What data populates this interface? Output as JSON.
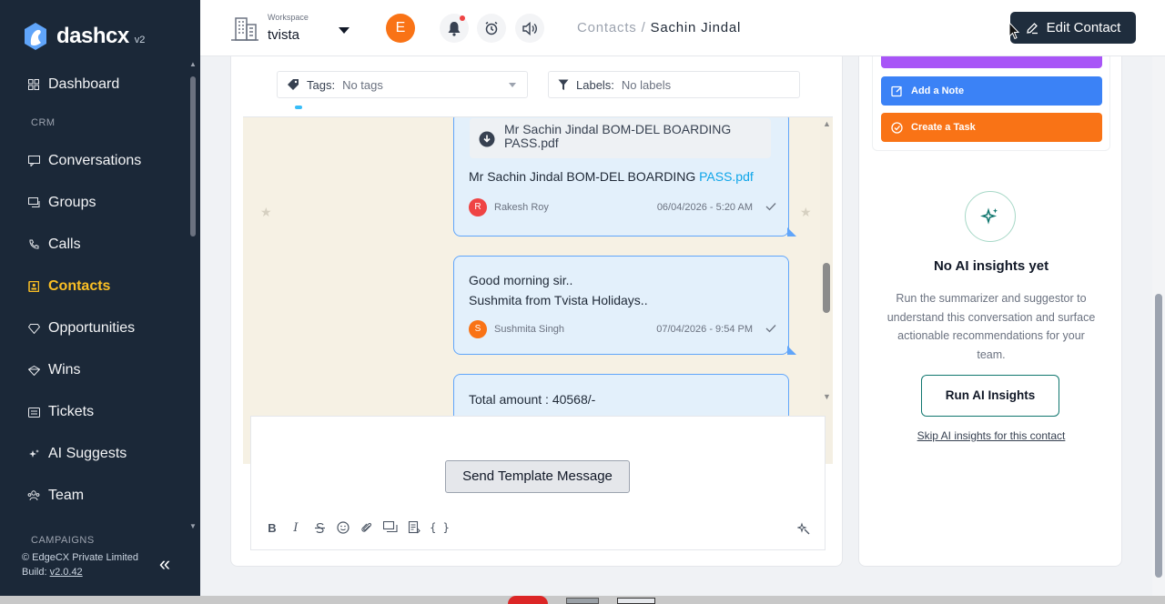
{
  "app": {
    "name": "dashcx",
    "version": "v2"
  },
  "sidebar": {
    "items": [
      {
        "label": "Dashboard",
        "icon": "dashboard-icon"
      },
      {
        "section": "CRM"
      },
      {
        "label": "Conversations",
        "icon": "chat-icon"
      },
      {
        "label": "Groups",
        "icon": "group-chat-icon"
      },
      {
        "label": "Calls",
        "icon": "phone-icon"
      },
      {
        "label": "Contacts",
        "icon": "contacts-icon",
        "active": true
      },
      {
        "label": "Opportunities",
        "icon": "diamond-icon"
      },
      {
        "label": "Wins",
        "icon": "trophy-icon"
      },
      {
        "label": "Tickets",
        "icon": "ticket-icon"
      },
      {
        "label": "AI Suggests",
        "icon": "sparkle-icon"
      },
      {
        "label": "Team",
        "icon": "team-icon"
      },
      {
        "section": "CAMPAIGNS"
      }
    ],
    "footer": {
      "company": "© EdgeCX Private Limited",
      "build_label": "Build:",
      "build": "v2.0.42"
    },
    "accent": "#fbbf24",
    "bg": "#1b2838"
  },
  "topbar": {
    "workspace_label": "Workspace",
    "workspace_name": "tvista",
    "user_initial": "E",
    "breadcrumb_parent": "Contacts",
    "breadcrumb_sep": "/",
    "breadcrumb_current": "Sachin Jindal",
    "edit_button": "Edit Contact"
  },
  "filters": {
    "tags_label": "Tags:",
    "tags_value": "No tags",
    "labels_label": "Labels:",
    "labels_value": "No labels"
  },
  "messages": [
    {
      "file_name": "Mr Sachin Jindal BOM-DEL BOARDING PASS.pdf",
      "text": "Mr Sachin Jindal BOM-DEL BOARDING",
      "link": "PASS.pdf",
      "sender_initial": "R",
      "sender": "Rakesh Roy",
      "time": "06/04/2026 - 5:20 AM",
      "avatar_color": "#ef4444"
    },
    {
      "line1": "Good morning sir..",
      "line2": "Sushmita from Tvista Holidays..",
      "sender_initial": "S",
      "sender": "Sushmita Singh",
      "time": "07/04/2026 - 9:54 PM",
      "avatar_color": "#f97316"
    },
    {
      "text": "Total amount : 40568/-"
    }
  ],
  "compose": {
    "send_template": "Send Template Message",
    "code_glyph": "{ }"
  },
  "actions": {
    "add_note": "Add a Note",
    "create_task": "Create a Task"
  },
  "ai": {
    "title": "No AI insights yet",
    "description": "Run the summarizer and suggestor to understand this conversation and surface actionable recommendations for your team.",
    "run_button": "Run AI Insights",
    "skip": "Skip AI insights for this contact"
  }
}
